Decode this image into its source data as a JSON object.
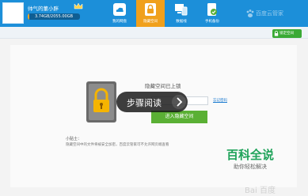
{
  "user": {
    "name": "帅气的董小胖",
    "storage": "3.74GB/2055.00GB",
    "storage_used_fraction": 0.0018
  },
  "nav": [
    {
      "label": "我的网盘",
      "icon": "cloud-drive-icon",
      "active": false
    },
    {
      "label": "隐藏空间",
      "icon": "lock-icon",
      "active": true
    },
    {
      "label": "数据线",
      "icon": "transfer-icon",
      "active": false
    },
    {
      "label": "手机备份",
      "icon": "phone-backup-icon",
      "active": false
    }
  ],
  "brand": {
    "text": "百度云管家",
    "icon": "baidu-paw-icon"
  },
  "action": {
    "lock_space": "锁定空间"
  },
  "locked": {
    "title": "隐藏空间已上锁",
    "password_placeholder": "",
    "forgot_link": "忘记密码",
    "enter_button": "进入隐藏空间"
  },
  "tips": {
    "title": "小贴士：",
    "text": "隐藏空间中的文件将被安全加密，百度云管家可不允许网页端查看"
  },
  "overlay": {
    "step_read": "步骤阅读"
  },
  "baike": {
    "title": "百科全说",
    "subtitle": "助你轻松解决"
  },
  "watermark": "Bai 百度"
}
